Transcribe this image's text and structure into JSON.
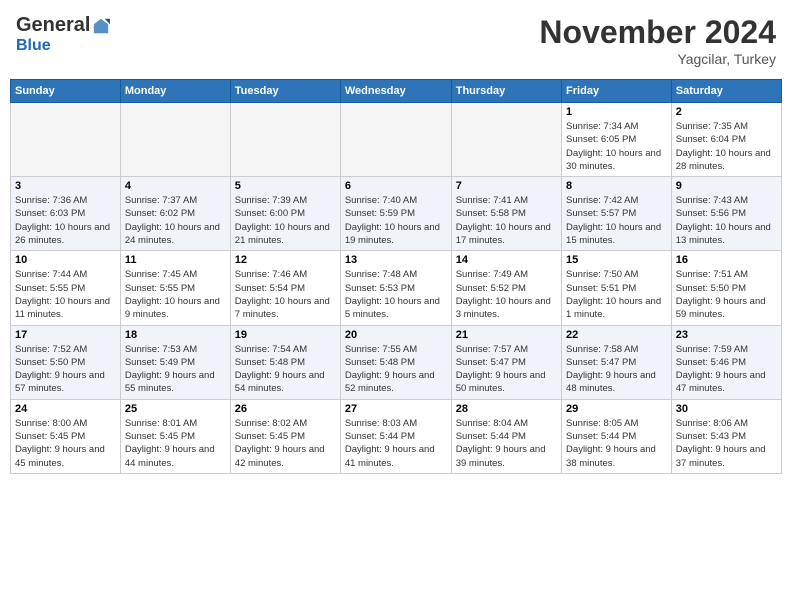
{
  "header": {
    "logo_general": "General",
    "logo_blue": "Blue",
    "month_title": "November 2024",
    "subtitle": "Yagcilar, Turkey"
  },
  "weekdays": [
    "Sunday",
    "Monday",
    "Tuesday",
    "Wednesday",
    "Thursday",
    "Friday",
    "Saturday"
  ],
  "weeks": [
    [
      {
        "day": "",
        "info": ""
      },
      {
        "day": "",
        "info": ""
      },
      {
        "day": "",
        "info": ""
      },
      {
        "day": "",
        "info": ""
      },
      {
        "day": "",
        "info": ""
      },
      {
        "day": "1",
        "info": "Sunrise: 7:34 AM\nSunset: 6:05 PM\nDaylight: 10 hours and 30 minutes."
      },
      {
        "day": "2",
        "info": "Sunrise: 7:35 AM\nSunset: 6:04 PM\nDaylight: 10 hours and 28 minutes."
      }
    ],
    [
      {
        "day": "3",
        "info": "Sunrise: 7:36 AM\nSunset: 6:03 PM\nDaylight: 10 hours and 26 minutes."
      },
      {
        "day": "4",
        "info": "Sunrise: 7:37 AM\nSunset: 6:02 PM\nDaylight: 10 hours and 24 minutes."
      },
      {
        "day": "5",
        "info": "Sunrise: 7:39 AM\nSunset: 6:00 PM\nDaylight: 10 hours and 21 minutes."
      },
      {
        "day": "6",
        "info": "Sunrise: 7:40 AM\nSunset: 5:59 PM\nDaylight: 10 hours and 19 minutes."
      },
      {
        "day": "7",
        "info": "Sunrise: 7:41 AM\nSunset: 5:58 PM\nDaylight: 10 hours and 17 minutes."
      },
      {
        "day": "8",
        "info": "Sunrise: 7:42 AM\nSunset: 5:57 PM\nDaylight: 10 hours and 15 minutes."
      },
      {
        "day": "9",
        "info": "Sunrise: 7:43 AM\nSunset: 5:56 PM\nDaylight: 10 hours and 13 minutes."
      }
    ],
    [
      {
        "day": "10",
        "info": "Sunrise: 7:44 AM\nSunset: 5:55 PM\nDaylight: 10 hours and 11 minutes."
      },
      {
        "day": "11",
        "info": "Sunrise: 7:45 AM\nSunset: 5:55 PM\nDaylight: 10 hours and 9 minutes."
      },
      {
        "day": "12",
        "info": "Sunrise: 7:46 AM\nSunset: 5:54 PM\nDaylight: 10 hours and 7 minutes."
      },
      {
        "day": "13",
        "info": "Sunrise: 7:48 AM\nSunset: 5:53 PM\nDaylight: 10 hours and 5 minutes."
      },
      {
        "day": "14",
        "info": "Sunrise: 7:49 AM\nSunset: 5:52 PM\nDaylight: 10 hours and 3 minutes."
      },
      {
        "day": "15",
        "info": "Sunrise: 7:50 AM\nSunset: 5:51 PM\nDaylight: 10 hours and 1 minute."
      },
      {
        "day": "16",
        "info": "Sunrise: 7:51 AM\nSunset: 5:50 PM\nDaylight: 9 hours and 59 minutes."
      }
    ],
    [
      {
        "day": "17",
        "info": "Sunrise: 7:52 AM\nSunset: 5:50 PM\nDaylight: 9 hours and 57 minutes."
      },
      {
        "day": "18",
        "info": "Sunrise: 7:53 AM\nSunset: 5:49 PM\nDaylight: 9 hours and 55 minutes."
      },
      {
        "day": "19",
        "info": "Sunrise: 7:54 AM\nSunset: 5:48 PM\nDaylight: 9 hours and 54 minutes."
      },
      {
        "day": "20",
        "info": "Sunrise: 7:55 AM\nSunset: 5:48 PM\nDaylight: 9 hours and 52 minutes."
      },
      {
        "day": "21",
        "info": "Sunrise: 7:57 AM\nSunset: 5:47 PM\nDaylight: 9 hours and 50 minutes."
      },
      {
        "day": "22",
        "info": "Sunrise: 7:58 AM\nSunset: 5:47 PM\nDaylight: 9 hours and 48 minutes."
      },
      {
        "day": "23",
        "info": "Sunrise: 7:59 AM\nSunset: 5:46 PM\nDaylight: 9 hours and 47 minutes."
      }
    ],
    [
      {
        "day": "24",
        "info": "Sunrise: 8:00 AM\nSunset: 5:45 PM\nDaylight: 9 hours and 45 minutes."
      },
      {
        "day": "25",
        "info": "Sunrise: 8:01 AM\nSunset: 5:45 PM\nDaylight: 9 hours and 44 minutes."
      },
      {
        "day": "26",
        "info": "Sunrise: 8:02 AM\nSunset: 5:45 PM\nDaylight: 9 hours and 42 minutes."
      },
      {
        "day": "27",
        "info": "Sunrise: 8:03 AM\nSunset: 5:44 PM\nDaylight: 9 hours and 41 minutes."
      },
      {
        "day": "28",
        "info": "Sunrise: 8:04 AM\nSunset: 5:44 PM\nDaylight: 9 hours and 39 minutes."
      },
      {
        "day": "29",
        "info": "Sunrise: 8:05 AM\nSunset: 5:44 PM\nDaylight: 9 hours and 38 minutes."
      },
      {
        "day": "30",
        "info": "Sunrise: 8:06 AM\nSunset: 5:43 PM\nDaylight: 9 hours and 37 minutes."
      }
    ]
  ]
}
